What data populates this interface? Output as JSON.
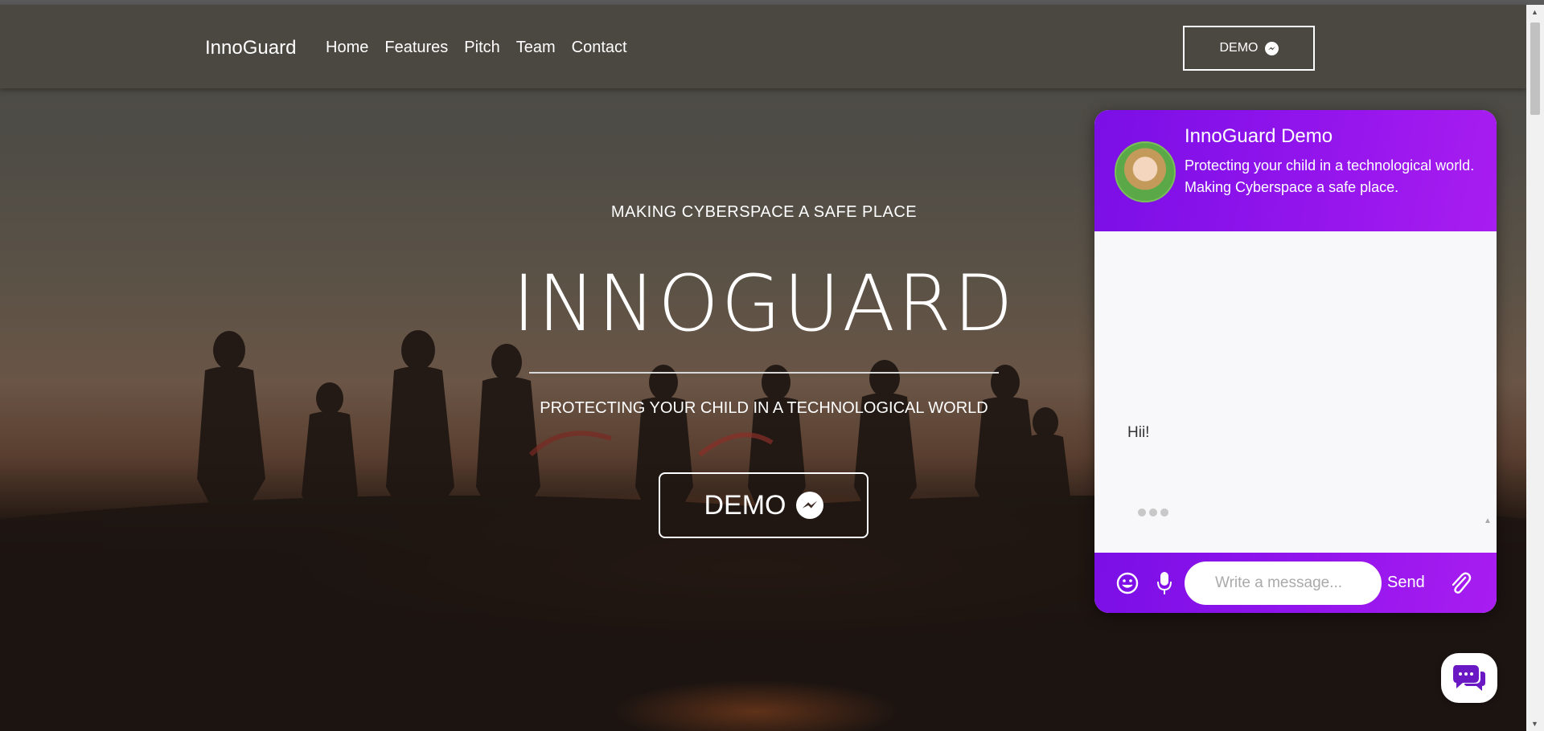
{
  "nav": {
    "brand": "InnoGuard",
    "links": [
      "Home",
      "Features",
      "Pitch",
      "Team",
      "Contact"
    ],
    "demo_label": "DEMO"
  },
  "hero": {
    "kicker": "MAKING CYBERSPACE A SAFE PLACE",
    "title": "INNOGUARD",
    "tagline": "PROTECTING YOUR CHILD IN A TECHNOLOGICAL WORLD",
    "demo_label": "DEMO"
  },
  "chat": {
    "title": "InnoGuard Demo",
    "subtitle": "Protecting your child in a technological world. Making Cyberspace a safe place.",
    "messages": [
      {
        "text": "Hii!"
      }
    ],
    "input_placeholder": "Write a message...",
    "send_label": "Send",
    "accent": "#9114ec"
  },
  "icons": {
    "messenger": "messenger-icon",
    "emoji": "smiley-icon",
    "mic": "microphone-icon",
    "attach": "paperclip-icon",
    "launcher": "chat-bubbles-icon"
  }
}
